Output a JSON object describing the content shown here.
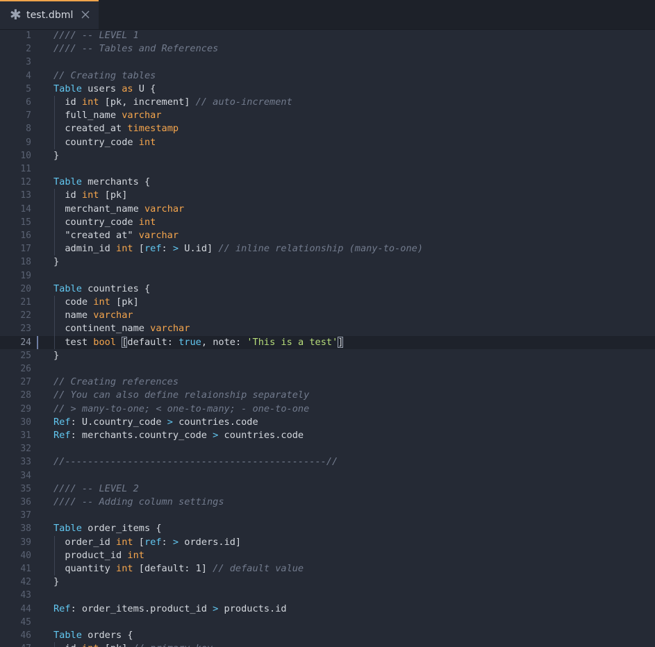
{
  "tab": {
    "title": "test.dbml",
    "modified_icon": "asterisk-icon",
    "close_icon": "close-icon"
  },
  "editor": {
    "current_line": 24,
    "lines": [
      [
        [
          "c",
          "//// -- LEVEL 1"
        ]
      ],
      [
        [
          "c",
          "//// -- Tables and References"
        ]
      ],
      [],
      [
        [
          "c",
          "// Creating tables"
        ]
      ],
      [
        [
          "k",
          "Table"
        ],
        [
          "p",
          " users "
        ],
        [
          "y",
          "as"
        ],
        [
          "p",
          " U {"
        ]
      ],
      [
        [
          "p",
          "  id "
        ],
        [
          "y",
          "int"
        ],
        [
          "p",
          " [pk, increment] "
        ],
        [
          "c",
          "// auto-increment"
        ]
      ],
      [
        [
          "p",
          "  full_name "
        ],
        [
          "y",
          "varchar"
        ]
      ],
      [
        [
          "p",
          "  created_at "
        ],
        [
          "y",
          "timestamp"
        ]
      ],
      [
        [
          "p",
          "  country_code "
        ],
        [
          "y",
          "int"
        ]
      ],
      [
        [
          "p",
          "}"
        ]
      ],
      [],
      [
        [
          "k",
          "Table"
        ],
        [
          "p",
          " merchants {"
        ]
      ],
      [
        [
          "p",
          "  id "
        ],
        [
          "y",
          "int"
        ],
        [
          "p",
          " [pk]"
        ]
      ],
      [
        [
          "p",
          "  merchant_name "
        ],
        [
          "y",
          "varchar"
        ]
      ],
      [
        [
          "p",
          "  country_code "
        ],
        [
          "y",
          "int"
        ]
      ],
      [
        [
          "p",
          "  \"created at\" "
        ],
        [
          "y",
          "varchar"
        ]
      ],
      [
        [
          "p",
          "  admin_id "
        ],
        [
          "y",
          "int"
        ],
        [
          "p",
          " ["
        ],
        [
          "k",
          "ref"
        ],
        [
          "p",
          ": "
        ],
        [
          "k",
          ">"
        ],
        [
          "p",
          " U.id] "
        ],
        [
          "c",
          "// inline relationship (many-to-one)"
        ]
      ],
      [
        [
          "p",
          "}"
        ]
      ],
      [],
      [
        [
          "k",
          "Table"
        ],
        [
          "p",
          " countries {"
        ]
      ],
      [
        [
          "p",
          "  code "
        ],
        [
          "y",
          "int"
        ],
        [
          "p",
          " [pk]"
        ]
      ],
      [
        [
          "p",
          "  name "
        ],
        [
          "y",
          "varchar"
        ]
      ],
      [
        [
          "p",
          "  continent_name "
        ],
        [
          "y",
          "varchar"
        ]
      ],
      [
        [
          "p",
          "  test "
        ],
        [
          "y",
          "bool"
        ],
        [
          "p",
          " "
        ],
        [
          "b",
          "["
        ],
        [
          "p",
          "default: "
        ],
        [
          "k",
          "true"
        ],
        [
          "p",
          ", note: "
        ],
        [
          "s",
          "'This is a test'"
        ],
        [
          "b",
          "]"
        ]
      ],
      [
        [
          "p",
          "}"
        ]
      ],
      [],
      [
        [
          "c",
          "// Creating references"
        ]
      ],
      [
        [
          "c",
          "// You can also define relaionship separately"
        ]
      ],
      [
        [
          "c",
          "// > many-to-one; < one-to-many; - one-to-one"
        ]
      ],
      [
        [
          "k",
          "Ref"
        ],
        [
          "p",
          ": U.country_code "
        ],
        [
          "k",
          ">"
        ],
        [
          "p",
          " countries.code"
        ]
      ],
      [
        [
          "k",
          "Ref"
        ],
        [
          "p",
          ": merchants.country_code "
        ],
        [
          "k",
          ">"
        ],
        [
          "p",
          " countries.code"
        ]
      ],
      [],
      [
        [
          "c",
          "//----------------------------------------------//"
        ]
      ],
      [],
      [
        [
          "c",
          "//// -- LEVEL 2"
        ]
      ],
      [
        [
          "c",
          "//// -- Adding column settings"
        ]
      ],
      [],
      [
        [
          "k",
          "Table"
        ],
        [
          "p",
          " order_items {"
        ]
      ],
      [
        [
          "p",
          "  order_id "
        ],
        [
          "y",
          "int"
        ],
        [
          "p",
          " ["
        ],
        [
          "k",
          "ref"
        ],
        [
          "p",
          ": "
        ],
        [
          "k",
          ">"
        ],
        [
          "p",
          " orders.id]"
        ]
      ],
      [
        [
          "p",
          "  product_id "
        ],
        [
          "y",
          "int"
        ]
      ],
      [
        [
          "p",
          "  quantity "
        ],
        [
          "y",
          "int"
        ],
        [
          "p",
          " [default: 1] "
        ],
        [
          "c",
          "// default value"
        ]
      ],
      [
        [
          "p",
          "}"
        ]
      ],
      [],
      [
        [
          "k",
          "Ref"
        ],
        [
          "p",
          ": order_items.product_id "
        ],
        [
          "k",
          ">"
        ],
        [
          "p",
          " products.id"
        ]
      ],
      [],
      [
        [
          "k",
          "Table"
        ],
        [
          "p",
          " orders {"
        ]
      ],
      [
        [
          "p",
          "  id "
        ],
        [
          "y",
          "int"
        ],
        [
          "p",
          " [pk] "
        ],
        [
          "c",
          "// primary key"
        ]
      ]
    ]
  },
  "colors": {
    "background": "#252a35",
    "keyword": "#62c7f0",
    "type": "#f6a64d",
    "comment": "#727b8d",
    "string": "#b7dd7a",
    "text": "#d4d8de",
    "tab_accent": "#f0a44b"
  }
}
